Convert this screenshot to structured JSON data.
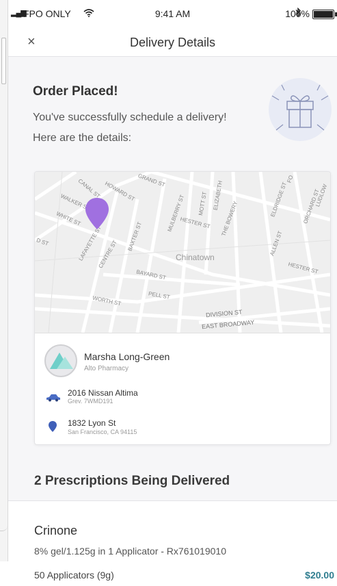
{
  "status_bar": {
    "carrier": "FPO ONLY",
    "time": "9:41 AM",
    "battery": "100%"
  },
  "nav": {
    "close": "×",
    "title": "Delivery Details"
  },
  "confirmation": {
    "heading": "Order Placed!",
    "message": "You've successfully schedule a delivery! Here are the details:"
  },
  "map": {
    "streets": [
      "CANAL ST",
      "HOWARD ST",
      "GRAND ST",
      "WALKER ST",
      "WHITE ST",
      "LAFAYETTE ST",
      "CENTRE ST",
      "BAXTER ST",
      "MULBERRY ST",
      "MOTT ST",
      "ELIZABETH",
      "HESTER ST",
      "THE BOWERY",
      "ELDRIDGE ST",
      "ORCHARD ST",
      "LUDLOW",
      "ALLEN ST",
      "HESTER ST",
      "BAYARD ST",
      "PELL ST",
      "WORTH ST",
      "DIVISION ST",
      "EAST BROADWAY",
      "D ST",
      "FO"
    ],
    "district": "Chinatown"
  },
  "driver": {
    "name": "Marsha Long-Green",
    "company": "Alto Pharmacy"
  },
  "vehicle": {
    "model": "2016 Nissan Altima",
    "plate": "Grev. 7WMD191"
  },
  "destination": {
    "street": "1832 Lyon St",
    "city": "San Francisco, CA 94115"
  },
  "prescriptions": {
    "heading": "2 Prescriptions Being Delivered",
    "items": [
      {
        "name": "Crinone",
        "description": "8% gel/1.125g in 1 Applicator - Rx761019010",
        "quantity": "50 Applicators (9g)",
        "price": "$20.00"
      }
    ]
  },
  "colors": {
    "accent": "#a070e0",
    "price": "#2f7d8f",
    "car": "#4a6cc4"
  }
}
